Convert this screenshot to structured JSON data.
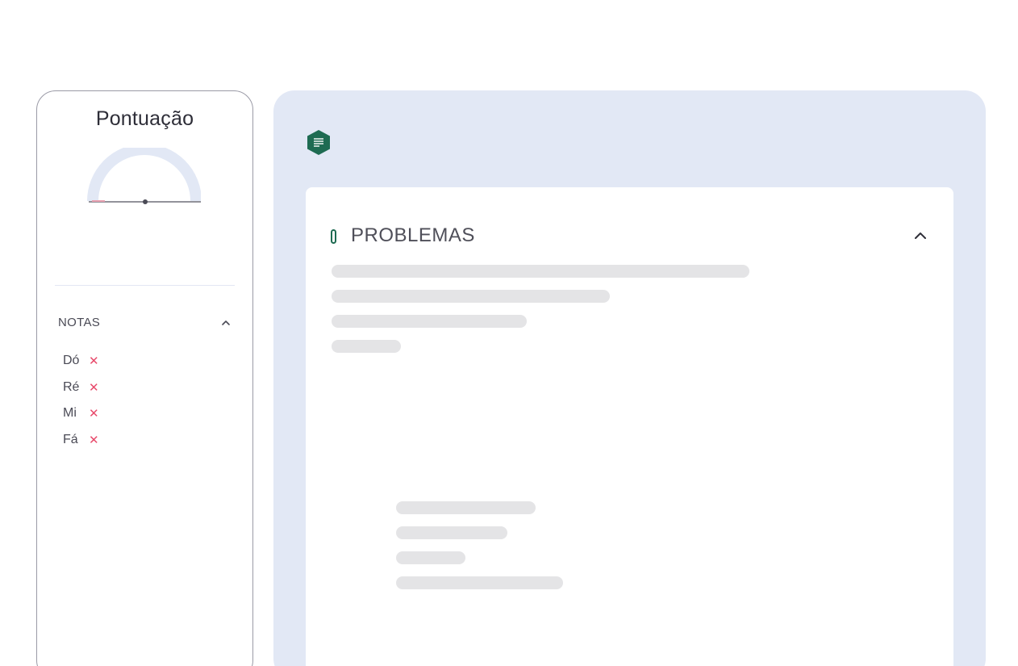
{
  "score_panel": {
    "title": "Pontuação",
    "gauge_fraction": 0.0,
    "notes": {
      "title": "NOTAS",
      "items": [
        {
          "label": "Dó",
          "status": "incorrect"
        },
        {
          "label": "Ré",
          "status": "incorrect"
        },
        {
          "label": "Mi",
          "status": "incorrect"
        },
        {
          "label": "Fá",
          "status": "incorrect"
        }
      ],
      "remove_glyph": "✕"
    }
  },
  "main_panel": {
    "badge_icon": "document-lines-icon",
    "card": {
      "title": "PROBLEMAS",
      "expanded": true
    }
  },
  "colors": {
    "accent_green": "#1e6b52",
    "panel_bg": "#e2e8f5",
    "error_red": "#e84a6b",
    "skeleton": "#e4e4e6"
  }
}
